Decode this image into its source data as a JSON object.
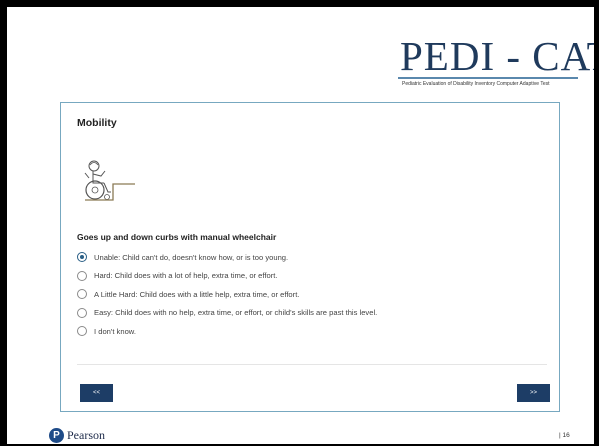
{
  "logo": {
    "main": "PEDI - CAT",
    "subtitle": "Pediatric Evaluation of Disability Inventory Computer Adaptive Test"
  },
  "panel": {
    "title": "Mobility",
    "illustration_icon": "child-in-wheelchair-icon",
    "question": "Goes up and down curbs with manual wheelchair",
    "selected_index": 0,
    "options": [
      {
        "label": "Unable: Child can't do, doesn't know how, or is too young."
      },
      {
        "label": "Hard: Child does with a lot of help, extra time, or effort."
      },
      {
        "label": "A Little Hard: Child does with a little help, extra time, or effort."
      },
      {
        "label": "Easy: Child does with no help, extra time, or effort, or child's skills are past this level."
      },
      {
        "label": "I don't know."
      }
    ],
    "prev_label": "<<",
    "next_label": ">>"
  },
  "footer": {
    "brand": "Pearson",
    "page_number": "| 16"
  },
  "colors": {
    "navy": "#1d3d66",
    "panel_border": "#77a8c0",
    "logo_text": "#1f3a5c"
  }
}
